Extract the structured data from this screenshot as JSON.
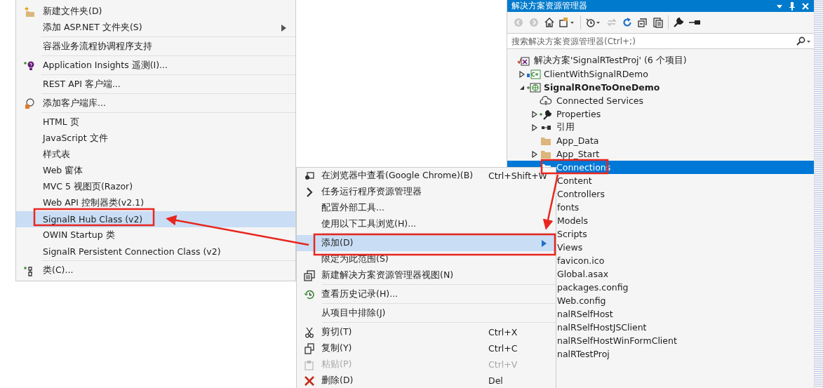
{
  "add_submenu": {
    "groups": [
      {
        "items": [
          {
            "label": "新建文件夹(D)",
            "kind": "new-folder",
            "submenu": false,
            "selected": false
          },
          {
            "label": "添加 ASP.NET 文件夹(S)",
            "kind": "plain",
            "submenu": true,
            "selected": false
          }
        ]
      },
      {
        "items": [
          {
            "label": "容器业务流程协调程序支持",
            "kind": "plain",
            "submenu": false,
            "selected": false
          }
        ]
      },
      {
        "items": [
          {
            "label": "Application Insights 遥测(I)...",
            "kind": "insights",
            "submenu": false,
            "selected": false
          }
        ]
      },
      {
        "items": [
          {
            "label": "REST API 客户端...",
            "kind": "plain",
            "submenu": false,
            "selected": false
          }
        ]
      },
      {
        "items": [
          {
            "label": "添加客户端库...",
            "kind": "library",
            "submenu": false,
            "selected": false
          }
        ]
      },
      {
        "items": [
          {
            "label": "HTML 页",
            "kind": "plain",
            "submenu": false,
            "selected": false
          },
          {
            "label": "JavaScript 文件",
            "kind": "plain",
            "submenu": false,
            "selected": false
          },
          {
            "label": "样式表",
            "kind": "plain",
            "submenu": false,
            "selected": false
          },
          {
            "label": "Web 窗体",
            "kind": "plain",
            "submenu": false,
            "selected": false
          },
          {
            "label": "MVC 5 视图页(Razor)",
            "kind": "plain",
            "submenu": false,
            "selected": false
          },
          {
            "label": "Web API 控制器类(v2.1)",
            "kind": "plain",
            "submenu": false,
            "selected": false
          },
          {
            "label": "SignalR Hub Class (v2)",
            "kind": "plain",
            "submenu": false,
            "selected": true
          },
          {
            "label": "OWIN Startup 类",
            "kind": "plain",
            "submenu": false,
            "selected": false
          },
          {
            "label": "SignalR Persistent Connection Class (v2)",
            "kind": "plain",
            "submenu": false,
            "selected": false
          }
        ]
      },
      {
        "items": [
          {
            "label": "类(C)...",
            "kind": "class",
            "submenu": false,
            "selected": false
          }
        ]
      }
    ]
  },
  "context_menu": {
    "groups": [
      {
        "items": [
          {
            "label": "在浏览器中查看(Google Chrome)(B)",
            "shortcut": "Ctrl+Shift+W",
            "kind": "browser",
            "selected": false,
            "disabled": false
          },
          {
            "label": "任务运行程序资源管理器",
            "kind": "chevron",
            "selected": false,
            "disabled": false
          },
          {
            "label": "配置外部工具...",
            "kind": "plain",
            "selected": false,
            "disabled": false
          },
          {
            "label": "使用以下工具浏览(H)...",
            "kind": "plain",
            "selected": false,
            "disabled": false
          }
        ]
      },
      {
        "items": [
          {
            "label": "添加(D)",
            "kind": "submenu",
            "selected": true,
            "disabled": false
          },
          {
            "label": "限定为此范围(S)",
            "kind": "plain",
            "selected": false,
            "disabled": false
          },
          {
            "label": "新建解决方案资源管理器视图(N)",
            "kind": "view",
            "selected": false,
            "disabled": false
          }
        ]
      },
      {
        "items": [
          {
            "label": "查看历史记录(H)...",
            "kind": "history",
            "selected": false,
            "disabled": false
          }
        ]
      },
      {
        "items": [
          {
            "label": "从项目中排除(J)",
            "kind": "plain",
            "selected": false,
            "disabled": false
          }
        ]
      },
      {
        "items": [
          {
            "label": "剪切(T)",
            "shortcut": "Ctrl+X",
            "kind": "cut",
            "selected": false,
            "disabled": false
          },
          {
            "label": "复制(Y)",
            "shortcut": "Ctrl+C",
            "kind": "copy",
            "selected": false,
            "disabled": false
          },
          {
            "label": "粘贴(P)",
            "shortcut": "Ctrl+V",
            "kind": "paste",
            "selected": false,
            "disabled": true
          },
          {
            "label": "删除(D)",
            "shortcut": "Del",
            "kind": "delete",
            "selected": false,
            "disabled": false
          }
        ]
      }
    ]
  },
  "solution_explorer": {
    "title": "解决方案资源管理器",
    "search": {
      "placeholder": "搜索解决方案资源管理器(Ctrl+;)"
    },
    "tree": [
      {
        "label": "解决方案'SignalRTestProj' (6 个项目)",
        "kind": "solution",
        "selected": false,
        "children": [
          {
            "label": "ClientWithSignalRDemo",
            "kind": "csharp-project",
            "expanded": false,
            "selected": false
          },
          {
            "label": "SignalROneToOneDemo",
            "kind": "startup-project",
            "expanded": true,
            "selected": false,
            "children": [
              {
                "label": "Connected Services",
                "kind": "connected",
                "selected": false
              },
              {
                "label": "Properties",
                "kind": "properties",
                "expanded": false,
                "selected": false
              },
              {
                "label": "引用",
                "kind": "references",
                "expanded": false,
                "selected": false
              },
              {
                "label": "App_Data",
                "kind": "folder",
                "selected": false
              },
              {
                "label": "App_Start",
                "kind": "folder",
                "expanded": false,
                "selected": false
              },
              {
                "label": "Connections",
                "kind": "folder",
                "selected": true
              },
              {
                "label": "Content",
                "kind": "covered",
                "selected": false
              },
              {
                "label": "Controllers",
                "kind": "covered",
                "selected": false
              },
              {
                "label": "fonts",
                "kind": "covered",
                "selected": false
              },
              {
                "label": "Models",
                "kind": "covered",
                "selected": false
              },
              {
                "label": "Scripts",
                "kind": "covered",
                "selected": false
              },
              {
                "label": "Views",
                "kind": "covered",
                "selected": false
              },
              {
                "label": "favicon.ico",
                "kind": "covered",
                "selected": false
              },
              {
                "label": "Global.asax",
                "kind": "covered",
                "selected": false
              },
              {
                "label": "packages.config",
                "kind": "covered",
                "selected": false
              },
              {
                "label": "Web.config",
                "kind": "covered",
                "selected": false
              }
            ]
          },
          {
            "label": "nalRSelfHost",
            "kind": "covered",
            "selected": false
          },
          {
            "label": "nalRSelfHostJSClient",
            "kind": "covered",
            "selected": false
          },
          {
            "label": "nalRSelfHostWinFormClient",
            "kind": "covered",
            "selected": false
          },
          {
            "label": "nalRTestProj",
            "kind": "covered",
            "selected": false
          }
        ]
      }
    ]
  }
}
